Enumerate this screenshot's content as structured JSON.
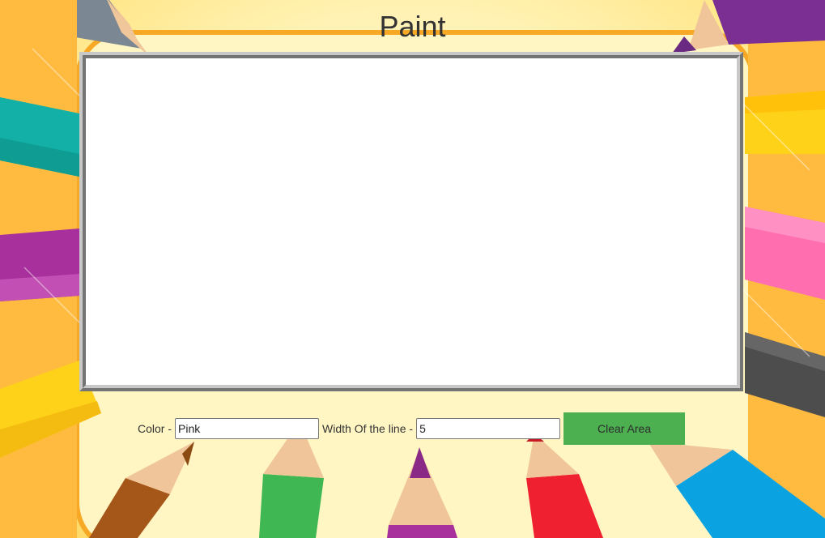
{
  "page": {
    "title": "Paint"
  },
  "controls": {
    "color_label": "Color -",
    "color_value": "Pink",
    "width_label": "Width Of the line -",
    "width_value": "5",
    "clear_button": "Clear Area"
  },
  "colors": {
    "button": "#4caf50",
    "canvas": "#ffffff"
  }
}
